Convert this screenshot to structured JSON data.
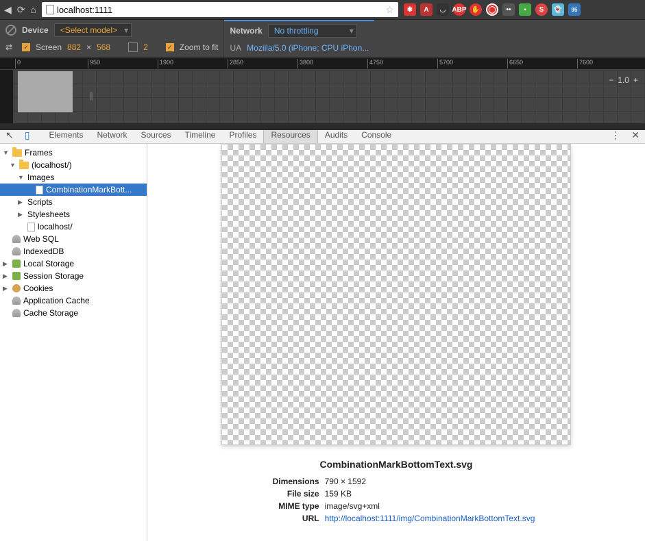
{
  "browser": {
    "url": "localhost:1111"
  },
  "device_toolbar": {
    "device_label": "Device",
    "select_model": "<Select model>",
    "screen_label": "Screen",
    "width": "882",
    "times": "×",
    "height": "568",
    "dpr": "2",
    "zoom_label": "Zoom to fit",
    "network_label": "Network",
    "throttling": "No throttling",
    "ua_label": "UA",
    "ua_value": "Mozilla/5.0 (iPhone; CPU iPhon..."
  },
  "ruler": {
    "ticks": [
      "0",
      "950",
      "1900",
      "2850",
      "3800",
      "4750",
      "5700",
      "6650",
      "7600"
    ]
  },
  "zoom": {
    "minus": "−",
    "value": "1.0",
    "plus": "+"
  },
  "devtools_tabs": {
    "elements": "Elements",
    "network": "Network",
    "sources": "Sources",
    "timeline": "Timeline",
    "profiles": "Profiles",
    "resources": "Resources",
    "audits": "Audits",
    "console": "Console"
  },
  "tree": {
    "frames": "Frames",
    "localhost": "(localhost/)",
    "images": "Images",
    "selected_file": "CombinationMarkBott...",
    "scripts": "Scripts",
    "stylesheets": "Stylesheets",
    "localhost_file": "localhost/",
    "websql": "Web SQL",
    "indexeddb": "IndexedDB",
    "localstorage": "Local Storage",
    "sessionstorage": "Session Storage",
    "cookies": "Cookies",
    "appcache": "Application Cache",
    "cachestorage": "Cache Storage"
  },
  "preview": {
    "filename": "CombinationMarkBottomText.svg",
    "dimensions_label": "Dimensions",
    "dimensions_value": "790 × 1592",
    "filesize_label": "File size",
    "filesize_value": "159 KB",
    "mime_label": "MIME type",
    "mime_value": "image/svg+xml",
    "url_label": "URL",
    "url_value": "http://localhost:1111/img/CombinationMarkBottomText.svg"
  }
}
